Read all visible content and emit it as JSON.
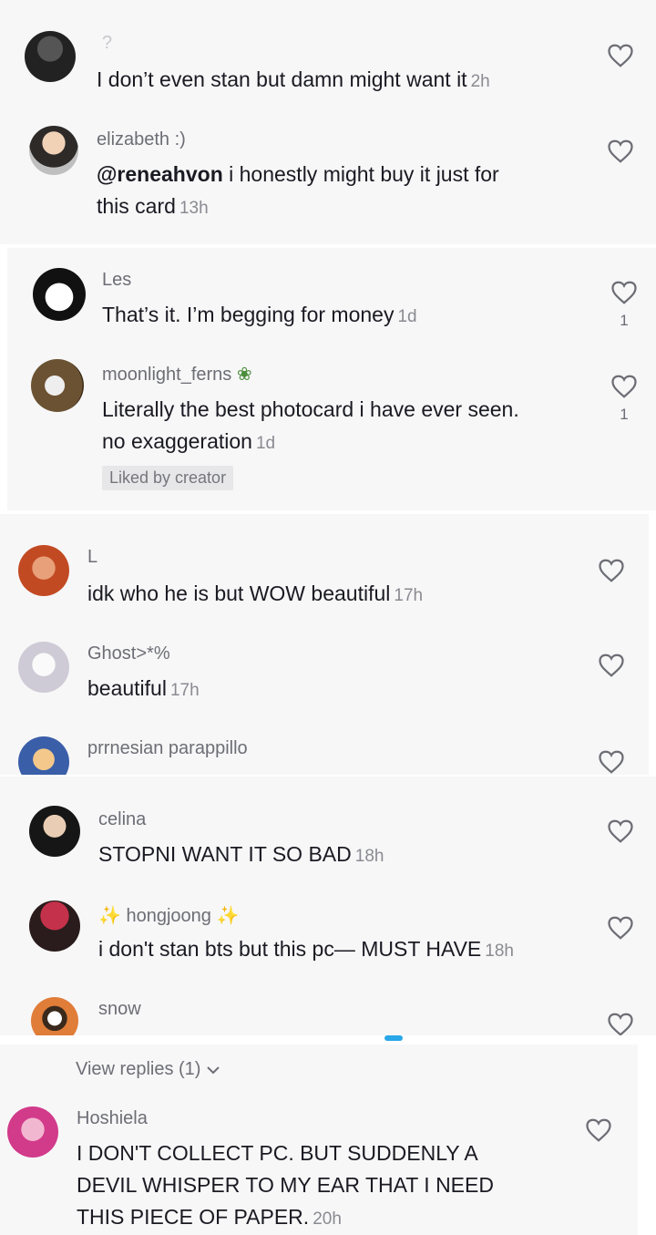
{
  "comments": [
    {
      "user": "?",
      "text": "I don’t even stan but damn might want it",
      "time": "2h"
    },
    {
      "user": "elizabeth :)",
      "mention": "@reneahvon",
      "text_line1": " i honestly might buy it just for",
      "text_line2": "this card",
      "time": "13h"
    },
    {
      "user": "Les",
      "text": "That’s it. I’m begging for money",
      "time": "1d",
      "likes": "1"
    },
    {
      "user": "moonlight_ferns",
      "text_line1": "Literally the best photocard i have ever seen.",
      "text_line2": "no exaggeration",
      "time": "1d",
      "likes": "1",
      "badge": "Liked by creator"
    },
    {
      "user": "L",
      "text": "idk who he is but WOW beautiful",
      "time": "17h"
    },
    {
      "user": "Ghost>*%",
      "text": "beautiful",
      "time": "17h"
    },
    {
      "user": "prrnesian parappillo"
    },
    {
      "user": "celina",
      "text": "STOPNI WANT IT SO BAD",
      "time": "18h"
    },
    {
      "user": "hongjoong",
      "sparkle": "✨",
      "text": "i don't stan bts but this pc— MUST HAVE",
      "time": "18h"
    },
    {
      "user": "snow"
    },
    {
      "view_replies": "View replies (1)"
    },
    {
      "user": "Hoshiela",
      "text_line1": "I DON'T COLLECT PC. BUT SUDDENLY A",
      "text_line2": "DEVIL WHISPER TO MY EAR THAT I NEED",
      "text_line3": "THIS PIECE OF PAPER.",
      "time": "20h"
    }
  ],
  "colors": {
    "background": "#f7f7f8",
    "text": "#1a1a22",
    "meta": "#6d6e75"
  },
  "icons": {
    "like": "heart-outline-icon"
  }
}
